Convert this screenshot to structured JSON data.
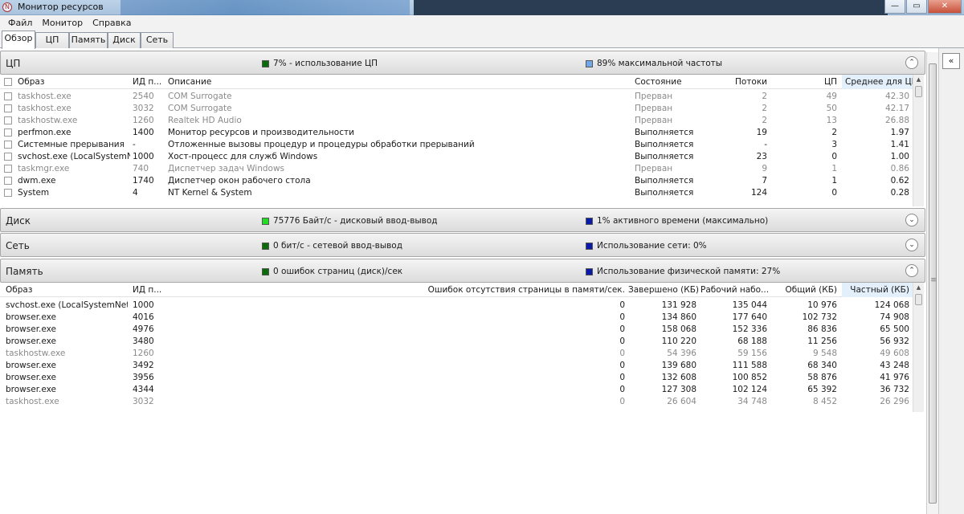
{
  "window": {
    "title": "Монитор ресурсов",
    "buttons": {
      "minimize": "—",
      "maximize": "▭",
      "close": "✕"
    }
  },
  "menu": [
    "Файл",
    "Монитор",
    "Справка"
  ],
  "tabs": [
    "Обзор",
    "ЦП",
    "Память",
    "Диск",
    "Сеть"
  ],
  "active_tab": "Обзор",
  "cpu": {
    "title": "ЦП",
    "stat1": {
      "text": "7% - использование ЦП",
      "color": "#0b6b0b"
    },
    "stat2": {
      "text": "89% максимальной частоты",
      "color": "#6fa8e8"
    },
    "toggle": "⌃",
    "headers": {
      "image": "Образ",
      "pid": "ИД п...",
      "desc": "Описание",
      "status": "Состояние",
      "threads": "Потоки",
      "cpu": "ЦП",
      "avg": "Среднее для ЦП"
    },
    "rows": [
      {
        "image": "taskhost.exe",
        "pid": "2540",
        "desc": "COM Surrogate",
        "status": "Прерван",
        "threads": "2",
        "cpu": "49",
        "avg": "42.30",
        "grey": true
      },
      {
        "image": "taskhost.exe",
        "pid": "3032",
        "desc": "COM Surrogate",
        "status": "Прерван",
        "threads": "2",
        "cpu": "50",
        "avg": "42.17",
        "grey": true
      },
      {
        "image": "taskhostw.exe",
        "pid": "1260",
        "desc": "Realtek HD Audio",
        "status": "Прерван",
        "threads": "2",
        "cpu": "13",
        "avg": "26.88",
        "grey": true
      },
      {
        "image": "perfmon.exe",
        "pid": "1400",
        "desc": "Монитор ресурсов и производительности",
        "status": "Выполняется",
        "threads": "19",
        "cpu": "2",
        "avg": "1.97",
        "grey": false
      },
      {
        "image": "Системные прерывания",
        "pid": "-",
        "desc": "Отложенные вызовы процедур и процедуры обработки прерываний",
        "status": "Выполняется",
        "threads": "-",
        "cpu": "3",
        "avg": "1.41",
        "grey": false
      },
      {
        "image": "svchost.exe (LocalSystemNet...",
        "pid": "1000",
        "desc": "Хост-процесс для служб Windows",
        "status": "Выполняется",
        "threads": "23",
        "cpu": "0",
        "avg": "1.00",
        "grey": false
      },
      {
        "image": "taskmgr.exe",
        "pid": "740",
        "desc": "Диспетчер задач Windows",
        "status": "Прерван",
        "threads": "9",
        "cpu": "1",
        "avg": "0.86",
        "grey": true
      },
      {
        "image": "dwm.exe",
        "pid": "1740",
        "desc": "Диспетчер окон рабочего стола",
        "status": "Выполняется",
        "threads": "7",
        "cpu": "1",
        "avg": "0.62",
        "grey": false
      },
      {
        "image": "System",
        "pid": "4",
        "desc": "NT Kernel & System",
        "status": "Выполняется",
        "threads": "124",
        "cpu": "0",
        "avg": "0.28",
        "grey": false
      }
    ]
  },
  "disk": {
    "title": "Диск",
    "stat1": {
      "text": "75776 Байт/с - дисковый ввод-вывод",
      "color": "#22dd22"
    },
    "stat2": {
      "text": "1% активного времени (максимально)",
      "color": "#0a1aa8"
    },
    "toggle": "⌄"
  },
  "network": {
    "title": "Сеть",
    "stat1": {
      "text": "0 бит/с - сетевой ввод-вывод",
      "color": "#0b6b0b"
    },
    "stat2": {
      "text": "Использование сети: 0%",
      "color": "#0a1aa8"
    },
    "toggle": "⌄"
  },
  "memory": {
    "title": "Память",
    "stat1": {
      "text": "0 ошибок страниц (диск)/сек",
      "color": "#0b6b0b"
    },
    "stat2": {
      "text": "Использование физической памяти: 27%",
      "color": "#0a1aa8"
    },
    "toggle": "⌃",
    "headers": {
      "image": "Образ",
      "pid": "ИД п...",
      "faults": "Ошибок отсутствия страницы в памяти/сек.",
      "commit": "Завершено (КБ)",
      "working": "Рабочий набо...",
      "shared": "Общий (КБ)",
      "private": "Частный (КБ)"
    },
    "rows": [
      {
        "image": "svchost.exe (LocalSystemNetwo...",
        "pid": "1000",
        "faults": "0",
        "commit": "131 928",
        "working": "135 044",
        "shared": "10 976",
        "private": "124 068",
        "grey": false
      },
      {
        "image": "browser.exe",
        "pid": "4016",
        "faults": "0",
        "commit": "134 860",
        "working": "177 640",
        "shared": "102 732",
        "private": "74 908",
        "grey": false
      },
      {
        "image": "browser.exe",
        "pid": "4976",
        "faults": "0",
        "commit": "158 068",
        "working": "152 336",
        "shared": "86 836",
        "private": "65 500",
        "grey": false
      },
      {
        "image": "browser.exe",
        "pid": "3480",
        "faults": "0",
        "commit": "110 220",
        "working": "68 188",
        "shared": "11 256",
        "private": "56 932",
        "grey": false
      },
      {
        "image": "taskhostw.exe",
        "pid": "1260",
        "faults": "0",
        "commit": "54 396",
        "working": "59 156",
        "shared": "9 548",
        "private": "49 608",
        "grey": true
      },
      {
        "image": "browser.exe",
        "pid": "3492",
        "faults": "0",
        "commit": "139 680",
        "working": "111 588",
        "shared": "68 340",
        "private": "43 248",
        "grey": false
      },
      {
        "image": "browser.exe",
        "pid": "3956",
        "faults": "0",
        "commit": "132 608",
        "working": "100 852",
        "shared": "58 876",
        "private": "41 976",
        "grey": false
      },
      {
        "image": "browser.exe",
        "pid": "4344",
        "faults": "0",
        "commit": "127 308",
        "working": "102 124",
        "shared": "65 392",
        "private": "36 732",
        "grey": false
      },
      {
        "image": "taskhost.exe",
        "pid": "3032",
        "faults": "0",
        "commit": "26 604",
        "working": "34 748",
        "shared": "8 452",
        "private": "26 296",
        "grey": true
      }
    ]
  },
  "sidebar": {
    "expand_icon": "«"
  }
}
